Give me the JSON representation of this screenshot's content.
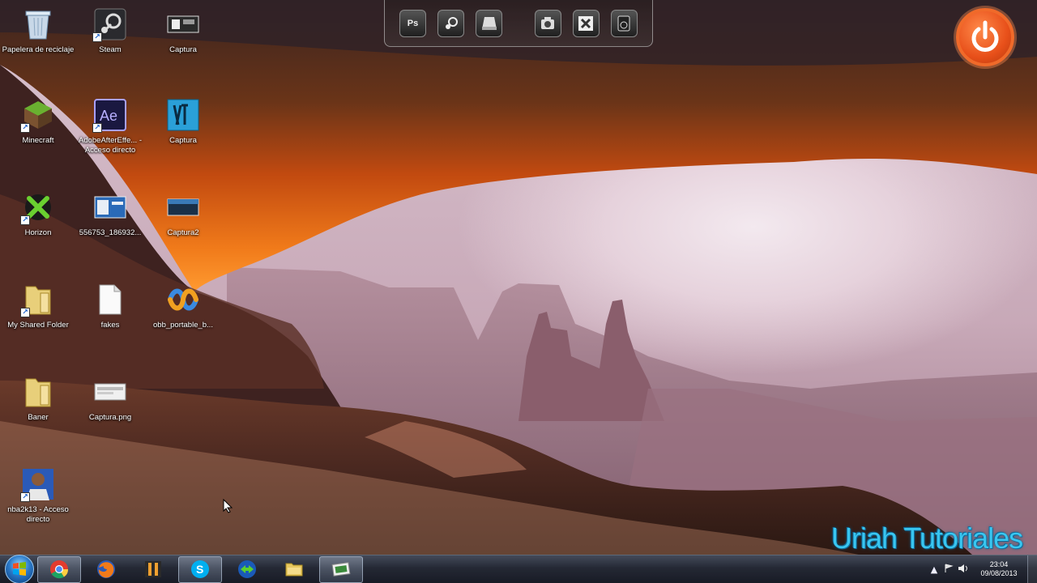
{
  "desktop": {
    "icons": [
      {
        "label": "Papelera de reciclaje"
      },
      {
        "label": "Steam"
      },
      {
        "label": "Captura"
      },
      {
        "label": "Minecraft"
      },
      {
        "label": "AdobeAfterEffe... - Acceso directo"
      },
      {
        "label": "Captura"
      },
      {
        "label": "Horizon"
      },
      {
        "label": "556753_186932..."
      },
      {
        "label": "Captura2"
      },
      {
        "label": "My Shared Folder"
      },
      {
        "label": "fakes"
      },
      {
        "label": "obb_portable_b..."
      },
      {
        "label": "Baner"
      },
      {
        "label": "Captura.png"
      },
      {
        "label": "nba2k13 - Acceso directo"
      }
    ]
  },
  "dock": {
    "items": [
      {
        "label": "Ps",
        "icon": "photoshop-icon"
      },
      {
        "label": "",
        "icon": "steam-icon"
      },
      {
        "label": "",
        "icon": "drive-icon"
      },
      {
        "label": "",
        "icon": "camera-icon"
      },
      {
        "label": "",
        "icon": "tool-icon"
      },
      {
        "label": "",
        "icon": "device-icon"
      }
    ]
  },
  "power_gadget": {
    "icon": "power-icon",
    "accent": "#e8501a"
  },
  "watermark": {
    "text": "Uriah Tutoriales",
    "color": "#39c6f0"
  },
  "taskbar": {
    "pinned": [
      {
        "icon": "chrome-icon"
      },
      {
        "icon": "firefox-icon"
      },
      {
        "icon": "fl-studio-icon"
      },
      {
        "icon": "skype-icon"
      },
      {
        "icon": "teamviewer-icon"
      },
      {
        "icon": "explorer-folder-icon"
      },
      {
        "icon": "photo-viewer-icon"
      }
    ],
    "tray": {
      "show_hidden": "▲",
      "time": "23:04",
      "date": "09/08/2013"
    }
  }
}
